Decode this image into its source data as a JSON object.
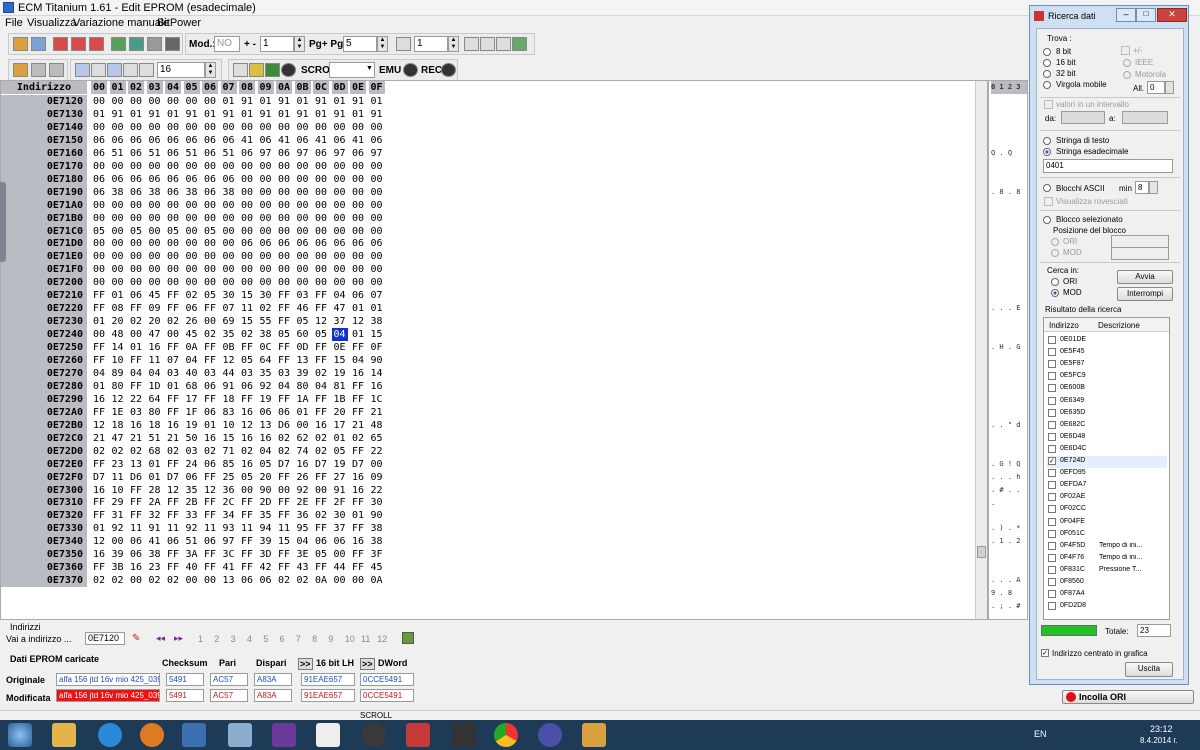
{
  "window": {
    "title": "ECM Titanium 1.61 - Edit EPROM (esadecimale)"
  },
  "menu": [
    "File",
    "Visualizza",
    "Variazione manuale",
    "BitPower"
  ],
  "toolbar1": {
    "mod_label": "Mod.:",
    "mod_value": "NO",
    "plusminus_label": "+ -",
    "plusminus_value": "1",
    "pg_label": "Pg+ Pg-",
    "pg_value": "5",
    "step_value": "1"
  },
  "toolbar2": {
    "cols_value": "16",
    "scroll_label": "SCROLL",
    "emu_label": "EMU",
    "rec_label": "REC"
  },
  "hex": {
    "header_addr": "Indirizzo",
    "columns": [
      "00",
      "01",
      "02",
      "03",
      "04",
      "05",
      "06",
      "07",
      "08",
      "09",
      "0A",
      "0B",
      "0C",
      "0D",
      "0E",
      "0F"
    ],
    "selected": {
      "row": 12,
      "col": 13
    },
    "rows": [
      {
        "addr": "0E7120",
        "bytes": [
          "00",
          "00",
          "00",
          "00",
          "00",
          "00",
          "00",
          "01",
          "91",
          "01",
          "91",
          "01",
          "91",
          "01",
          "91",
          "01"
        ]
      },
      {
        "addr": "0E7130",
        "bytes": [
          "01",
          "91",
          "01",
          "91",
          "01",
          "91",
          "01",
          "91",
          "01",
          "91",
          "01",
          "91",
          "01",
          "91",
          "01",
          "91"
        ]
      },
      {
        "addr": "0E7140",
        "bytes": [
          "00",
          "00",
          "00",
          "00",
          "00",
          "00",
          "00",
          "00",
          "00",
          "00",
          "00",
          "00",
          "00",
          "00",
          "00",
          "00"
        ]
      },
      {
        "addr": "0E7150",
        "bytes": [
          "06",
          "06",
          "06",
          "06",
          "06",
          "06",
          "06",
          "06",
          "41",
          "06",
          "41",
          "06",
          "41",
          "06",
          "41",
          "06"
        ]
      },
      {
        "addr": "0E7160",
        "bytes": [
          "06",
          "51",
          "06",
          "51",
          "06",
          "51",
          "06",
          "51",
          "06",
          "97",
          "06",
          "97",
          "06",
          "97",
          "06",
          "97"
        ]
      },
      {
        "addr": "0E7170",
        "bytes": [
          "00",
          "00",
          "00",
          "00",
          "00",
          "00",
          "00",
          "00",
          "00",
          "00",
          "00",
          "00",
          "00",
          "00",
          "00",
          "00"
        ]
      },
      {
        "addr": "0E7180",
        "bytes": [
          "06",
          "06",
          "06",
          "06",
          "06",
          "06",
          "06",
          "06",
          "00",
          "00",
          "00",
          "00",
          "00",
          "00",
          "00",
          "00"
        ]
      },
      {
        "addr": "0E7190",
        "bytes": [
          "06",
          "38",
          "06",
          "38",
          "06",
          "38",
          "06",
          "38",
          "00",
          "00",
          "00",
          "00",
          "00",
          "00",
          "00",
          "00"
        ]
      },
      {
        "addr": "0E71A0",
        "bytes": [
          "00",
          "00",
          "00",
          "00",
          "00",
          "00",
          "00",
          "00",
          "00",
          "00",
          "00",
          "00",
          "00",
          "00",
          "00",
          "00"
        ]
      },
      {
        "addr": "0E71B0",
        "bytes": [
          "00",
          "00",
          "00",
          "00",
          "00",
          "00",
          "00",
          "00",
          "00",
          "00",
          "00",
          "00",
          "00",
          "00",
          "00",
          "00"
        ]
      },
      {
        "addr": "0E71C0",
        "bytes": [
          "05",
          "00",
          "05",
          "00",
          "05",
          "00",
          "05",
          "00",
          "00",
          "00",
          "00",
          "00",
          "00",
          "00",
          "00",
          "00"
        ]
      },
      {
        "addr": "0E71D0",
        "bytes": [
          "00",
          "00",
          "00",
          "00",
          "00",
          "00",
          "00",
          "00",
          "06",
          "06",
          "06",
          "06",
          "06",
          "06",
          "06",
          "06"
        ]
      },
      {
        "addr": "0E71E0",
        "bytes": [
          "00",
          "00",
          "00",
          "00",
          "00",
          "00",
          "00",
          "00",
          "00",
          "00",
          "00",
          "00",
          "00",
          "00",
          "00",
          "00"
        ]
      },
      {
        "addr": "0E71F0",
        "bytes": [
          "00",
          "00",
          "00",
          "00",
          "00",
          "00",
          "00",
          "00",
          "00",
          "00",
          "00",
          "00",
          "00",
          "00",
          "00",
          "00"
        ]
      },
      {
        "addr": "0E7200",
        "bytes": [
          "00",
          "00",
          "00",
          "00",
          "00",
          "00",
          "00",
          "00",
          "00",
          "00",
          "00",
          "00",
          "00",
          "00",
          "00",
          "00"
        ]
      },
      {
        "addr": "0E7210",
        "bytes": [
          "FF",
          "01",
          "06",
          "45",
          "FF",
          "02",
          "05",
          "30",
          "15",
          "30",
          "FF",
          "03",
          "FF",
          "04",
          "06",
          "07"
        ]
      },
      {
        "addr": "0E7220",
        "bytes": [
          "FF",
          "08",
          "FF",
          "09",
          "FF",
          "06",
          "FF",
          "07",
          "11",
          "02",
          "FF",
          "46",
          "FF",
          "47",
          "01",
          "01"
        ]
      },
      {
        "addr": "0E7230",
        "bytes": [
          "01",
          "20",
          "02",
          "20",
          "02",
          "26",
          "00",
          "69",
          "15",
          "55",
          "FF",
          "05",
          "12",
          "37",
          "12",
          "38"
        ]
      },
      {
        "addr": "0E7240",
        "bytes": [
          "00",
          "48",
          "00",
          "47",
          "00",
          "45",
          "02",
          "35",
          "02",
          "38",
          "05",
          "60",
          "05",
          "04",
          "01",
          "15"
        ]
      },
      {
        "addr": "0E7250",
        "bytes": [
          "FF",
          "14",
          "01",
          "16",
          "FF",
          "0A",
          "FF",
          "0B",
          "FF",
          "0C",
          "FF",
          "0D",
          "FF",
          "0E",
          "FF",
          "0F"
        ]
      },
      {
        "addr": "0E7260",
        "bytes": [
          "FF",
          "10",
          "FF",
          "11",
          "07",
          "04",
          "FF",
          "12",
          "05",
          "64",
          "FF",
          "13",
          "FF",
          "15",
          "04",
          "90"
        ]
      },
      {
        "addr": "0E7270",
        "bytes": [
          "04",
          "89",
          "04",
          "04",
          "03",
          "40",
          "03",
          "44",
          "03",
          "35",
          "03",
          "39",
          "02",
          "19",
          "16",
          "14"
        ]
      },
      {
        "addr": "0E7280",
        "bytes": [
          "01",
          "80",
          "FF",
          "1D",
          "01",
          "68",
          "06",
          "91",
          "06",
          "92",
          "04",
          "80",
          "04",
          "81",
          "FF",
          "16"
        ]
      },
      {
        "addr": "0E7290",
        "bytes": [
          "16",
          "12",
          "22",
          "64",
          "FF",
          "17",
          "FF",
          "18",
          "FF",
          "19",
          "FF",
          "1A",
          "FF",
          "1B",
          "FF",
          "1C"
        ]
      },
      {
        "addr": "0E72A0",
        "bytes": [
          "FF",
          "1E",
          "03",
          "80",
          "FF",
          "1F",
          "06",
          "83",
          "16",
          "06",
          "06",
          "01",
          "FF",
          "20",
          "FF",
          "21"
        ]
      },
      {
        "addr": "0E72B0",
        "bytes": [
          "12",
          "18",
          "16",
          "18",
          "16",
          "19",
          "01",
          "10",
          "12",
          "13",
          "D6",
          "00",
          "16",
          "17",
          "21",
          "48"
        ]
      },
      {
        "addr": "0E72C0",
        "bytes": [
          "21",
          "47",
          "21",
          "51",
          "21",
          "50",
          "16",
          "15",
          "16",
          "16",
          "02",
          "62",
          "02",
          "01",
          "02",
          "65"
        ]
      },
      {
        "addr": "0E72D0",
        "bytes": [
          "02",
          "02",
          "02",
          "68",
          "02",
          "03",
          "02",
          "71",
          "02",
          "04",
          "02",
          "74",
          "02",
          "05",
          "FF",
          "22"
        ]
      },
      {
        "addr": "0E72E0",
        "bytes": [
          "FF",
          "23",
          "13",
          "01",
          "FF",
          "24",
          "06",
          "85",
          "16",
          "05",
          "D7",
          "16",
          "D7",
          "19",
          "D7",
          "00"
        ]
      },
      {
        "addr": "0E72F0",
        "bytes": [
          "D7",
          "11",
          "D6",
          "01",
          "D7",
          "06",
          "FF",
          "25",
          "05",
          "20",
          "FF",
          "26",
          "FF",
          "27",
          "16",
          "09"
        ]
      },
      {
        "addr": "0E7300",
        "bytes": [
          "16",
          "10",
          "FF",
          "28",
          "12",
          "35",
          "12",
          "36",
          "00",
          "90",
          "00",
          "92",
          "00",
          "91",
          "16",
          "22"
        ]
      },
      {
        "addr": "0E7310",
        "bytes": [
          "FF",
          "29",
          "FF",
          "2A",
          "FF",
          "2B",
          "FF",
          "2C",
          "FF",
          "2D",
          "FF",
          "2E",
          "FF",
          "2F",
          "FF",
          "30"
        ]
      },
      {
        "addr": "0E7320",
        "bytes": [
          "FF",
          "31",
          "FF",
          "32",
          "FF",
          "33",
          "FF",
          "34",
          "FF",
          "35",
          "FF",
          "36",
          "02",
          "30",
          "01",
          "90"
        ]
      },
      {
        "addr": "0E7330",
        "bytes": [
          "01",
          "92",
          "11",
          "91",
          "11",
          "92",
          "11",
          "93",
          "11",
          "94",
          "11",
          "95",
          "FF",
          "37",
          "FF",
          "38"
        ]
      },
      {
        "addr": "0E7340",
        "bytes": [
          "12",
          "00",
          "06",
          "41",
          "06",
          "51",
          "06",
          "97",
          "FF",
          "39",
          "15",
          "04",
          "06",
          "06",
          "16",
          "38"
        ]
      },
      {
        "addr": "0E7350",
        "bytes": [
          "16",
          "39",
          "06",
          "38",
          "FF",
          "3A",
          "FF",
          "3C",
          "FF",
          "3D",
          "FF",
          "3E",
          "05",
          "00",
          "FF",
          "3F"
        ]
      },
      {
        "addr": "0E7360",
        "bytes": [
          "FF",
          "3B",
          "16",
          "23",
          "FF",
          "40",
          "FF",
          "41",
          "FF",
          "42",
          "FF",
          "43",
          "FF",
          "44",
          "FF",
          "45"
        ]
      },
      {
        "addr": "0E7370",
        "bytes": [
          "02",
          "02",
          "00",
          "02",
          "02",
          "00",
          "00",
          "13",
          "06",
          "06",
          "02",
          "02",
          "0A",
          "00",
          "00",
          "0A"
        ]
      }
    ]
  },
  "ascii": {
    "header": "0 1 2 3",
    "lines": [
      "",
      "",
      "",
      "",
      "Q . Q",
      "",
      "",
      ". 8 . 8",
      "",
      "",
      "",
      "",
      "",
      "",
      "",
      "",
      ". . . E",
      "",
      "",
      ". H . G",
      "",
      "",
      "",
      "",
      "",
      ". . \" d",
      "",
      "",
      ". G ! Q",
      ". . . h",
      ". # . . .",
      "",
      "",
      ". ) . *",
      ". 1 . 2",
      "",
      "",
      ". . . A",
      "9 . 8",
      ". ; . #",
      ""
    ]
  },
  "bottom": {
    "indirizzi_label": "Indirizzi",
    "goto_label": "Vai a indirizzo ...",
    "goto_value": "0E7120",
    "pages": [
      "1",
      "2",
      "3",
      "4",
      "5",
      "6",
      "7",
      "8",
      "9",
      "10",
      "11",
      "12"
    ],
    "eprom_label": "Dati EPROM caricate",
    "cols": {
      "checksum": "Checksum",
      "pari": "Pari",
      "dispari": "Dispari",
      "bit16": "16 bit LH",
      "dword": "DWord"
    },
    "originale": {
      "label": "Originale",
      "file": "alfa 156 jtd 16v mio 425_039.",
      "checksum": "5491",
      "pari": "AC57",
      "dispari": "A83A",
      "bit16": "91EAE657",
      "dword": "0CCE5491"
    },
    "modificata": {
      "label": "Modificata",
      "file": "alfa 156 jtd 16v mio 425_039.",
      "checksum": "5491",
      "pari": "AC57",
      "dispari": "A83A",
      "bit16": "91EAE657",
      "dword": "0CCE5491"
    },
    "incolla_label": "Incolla ORI",
    "status": "SCROLL"
  },
  "dialog": {
    "title": "Ricerca dati",
    "trova_label": "Trova :",
    "opt_8bit": "8 bit",
    "opt_16bit": "16 bit",
    "opt_32bit": "32 bit",
    "opt_virgola": "Virgola mobile",
    "plusminus": "+/-",
    "opt_ieee": "IEEE",
    "opt_motorola": "Motorola",
    "all_label": "All.",
    "all_value": "0",
    "intervallo_label": "valori in un intervallo",
    "da_label": "da:",
    "a_label": "a:",
    "stringa_testo": "Stringa di testo",
    "stringa_hex": "Stringa esadecimale",
    "search_value": "0401",
    "blocchi_ascii": "Blocchi ASCII",
    "min_label": "min",
    "min_value": "8",
    "visualizza_rov": "Visualizza rovesciati",
    "blocco_sel": "Blocco selezionato",
    "posizione_blocco": "Posizione del blocco",
    "pos_ori": "ORI",
    "pos_mod": "MOD",
    "cerca_in": "Cerca in:",
    "cerca_ori": "ORI",
    "cerca_mod": "MOD",
    "avvia": "Avvia",
    "interrompi": "Interrompi",
    "risultato_label": "Risultato della ricerca",
    "col_indirizzo": "Indirizzo",
    "col_descrizione": "Descrizione",
    "results": [
      {
        "addr": "0E01DE",
        "desc": "",
        "checked": false
      },
      {
        "addr": "0E5F45",
        "desc": "",
        "checked": false
      },
      {
        "addr": "0E5F87",
        "desc": "",
        "checked": false
      },
      {
        "addr": "0E5FC9",
        "desc": "",
        "checked": false
      },
      {
        "addr": "0E600B",
        "desc": "",
        "checked": false
      },
      {
        "addr": "0E6349",
        "desc": "",
        "checked": false
      },
      {
        "addr": "0E635D",
        "desc": "",
        "checked": false
      },
      {
        "addr": "0E682C",
        "desc": "",
        "checked": false
      },
      {
        "addr": "0E6D48",
        "desc": "",
        "checked": false
      },
      {
        "addr": "0E6D4C",
        "desc": "",
        "checked": false
      },
      {
        "addr": "0E724D",
        "desc": "",
        "checked": true
      },
      {
        "addr": "0EFD95",
        "desc": "",
        "checked": false
      },
      {
        "addr": "0EFDA7",
        "desc": "",
        "checked": false
      },
      {
        "addr": "0F02AE",
        "desc": "",
        "checked": false
      },
      {
        "addr": "0F02CC",
        "desc": "",
        "checked": false
      },
      {
        "addr": "0F04FE",
        "desc": "",
        "checked": false
      },
      {
        "addr": "0F051C",
        "desc": "",
        "checked": false
      },
      {
        "addr": "0F4F5D",
        "desc": "Tempo di ini...",
        "checked": false
      },
      {
        "addr": "0F4F76",
        "desc": "Tempo di ini...",
        "checked": false
      },
      {
        "addr": "0F831C",
        "desc": "Pressione T...",
        "checked": false
      },
      {
        "addr": "0F8560",
        "desc": "",
        "checked": false
      },
      {
        "addr": "0F87A4",
        "desc": "",
        "checked": false
      },
      {
        "addr": "0FD2D8",
        "desc": "",
        "checked": false
      }
    ],
    "totale_label": "Totale:",
    "totale_value": "23",
    "centrato_label": "Indirizzo centrato in grafica",
    "uscita": "Uscita"
  },
  "tray": {
    "lang": "EN",
    "time": "23:12",
    "date": "8.4.2014 г."
  }
}
